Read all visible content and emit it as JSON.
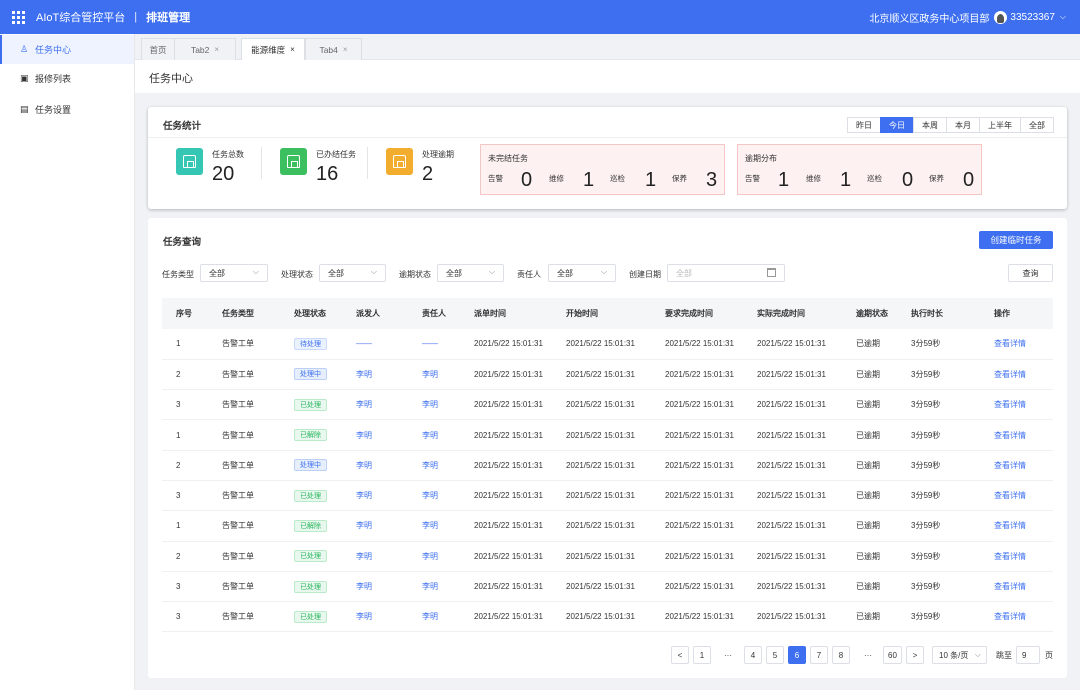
{
  "topbar": {
    "app_title": "AIoT综合管控平台",
    "separator": "|",
    "module_title": "排班管理",
    "project": "北京顺义区政务中心项目部",
    "user_id": "33523367"
  },
  "sidebar": {
    "items": [
      {
        "label": "任务中心",
        "icon": "user-icon",
        "active": true
      },
      {
        "label": "报修列表",
        "icon": "list-icon",
        "active": false
      },
      {
        "label": "任务设置",
        "icon": "settings-doc-icon",
        "active": false
      }
    ]
  },
  "tabs": [
    {
      "label": "首页",
      "closable": false,
      "active": false
    },
    {
      "label": "Tab2",
      "closable": true,
      "active": false
    },
    {
      "label": "能源维度",
      "closable": true,
      "active": true
    },
    {
      "label": "Tab4",
      "closable": true,
      "active": false
    }
  ],
  "close_glyph": "×",
  "page_title": "任务中心",
  "stats": {
    "title": "任务统计",
    "ranges": [
      "昨日",
      "今日",
      "本周",
      "本月",
      "上半年",
      "全部"
    ],
    "active_range": "今日",
    "kpis": [
      {
        "label": "任务总数",
        "value": "20",
        "color": "#36c6b4"
      },
      {
        "label": "已办结任务",
        "value": "16",
        "color": "#3cbf5e"
      },
      {
        "label": "处理逾期",
        "value": "2",
        "color": "#f3ad2e"
      }
    ],
    "unfinished": {
      "title": "未完结任务",
      "items": [
        {
          "label": "告警",
          "value": "0"
        },
        {
          "label": "维修",
          "value": "1"
        },
        {
          "label": "巡检",
          "value": "1"
        },
        {
          "label": "保养",
          "value": "3"
        }
      ]
    },
    "overdue": {
      "title": "逾期分布",
      "items": [
        {
          "label": "告警",
          "value": "1"
        },
        {
          "label": "维修",
          "value": "1"
        },
        {
          "label": "巡检",
          "value": "0"
        },
        {
          "label": "保养",
          "value": "0"
        }
      ]
    }
  },
  "query": {
    "title": "任务查询",
    "create_button": "创建临时任务",
    "filters": {
      "task_type": {
        "label": "任务类型",
        "value": "全部"
      },
      "status": {
        "label": "处理状态",
        "value": "全部"
      },
      "overdue": {
        "label": "逾期状态",
        "value": "全部"
      },
      "owner": {
        "label": "责任人",
        "value": "全部"
      },
      "created": {
        "label": "创建日期",
        "placeholder": "全部"
      }
    },
    "search_button": "查询",
    "columns": [
      "序号",
      "任务类型",
      "处理状态",
      "派发人",
      "责任人",
      "派单时间",
      "开始时间",
      "要求完成时间",
      "实际完成时间",
      "逾期状态",
      "执行时长",
      "操作"
    ],
    "rows": [
      {
        "no": "1",
        "type": "告警工单",
        "status": "待处理",
        "status_kind": "wait",
        "dispatcher": "——",
        "owner": "——",
        "dispatch_time": "2021/5/22  15:01:31",
        "start_time": "2021/5/22  15:01:31",
        "due_time": "2021/5/22  15:01:31",
        "done_time": "2021/5/22  15:01:31",
        "overdue": "已逾期",
        "duration": "3分59秒",
        "action": "查看详情"
      },
      {
        "no": "2",
        "type": "告警工单",
        "status": "处理中",
        "status_kind": "doing",
        "dispatcher": "李明",
        "owner": "李明",
        "dispatch_time": "2021/5/22  15:01:31",
        "start_time": "2021/5/22  15:01:31",
        "due_time": "2021/5/22  15:01:31",
        "done_time": "2021/5/22  15:01:31",
        "overdue": "已逾期",
        "duration": "3分59秒",
        "action": "查看详情"
      },
      {
        "no": "3",
        "type": "告警工单",
        "status": "已处理",
        "status_kind": "done",
        "dispatcher": "李明",
        "owner": "李明",
        "dispatch_time": "2021/5/22  15:01:31",
        "start_time": "2021/5/22  15:01:31",
        "due_time": "2021/5/22  15:01:31",
        "done_time": "2021/5/22  15:01:31",
        "overdue": "已逾期",
        "duration": "3分59秒",
        "action": "查看详情"
      },
      {
        "no": "1",
        "type": "告警工单",
        "status": "已解除",
        "status_kind": "done",
        "dispatcher": "李明",
        "owner": "李明",
        "dispatch_time": "2021/5/22  15:01:31",
        "start_time": "2021/5/22  15:01:31",
        "due_time": "2021/5/22  15:01:31",
        "done_time": "2021/5/22  15:01:31",
        "overdue": "已逾期",
        "duration": "3分59秒",
        "action": "查看详情"
      },
      {
        "no": "2",
        "type": "告警工单",
        "status": "处理中",
        "status_kind": "doing",
        "dispatcher": "李明",
        "owner": "李明",
        "dispatch_time": "2021/5/22  15:01:31",
        "start_time": "2021/5/22  15:01:31",
        "due_time": "2021/5/22  15:01:31",
        "done_time": "2021/5/22  15:01:31",
        "overdue": "已逾期",
        "duration": "3分59秒",
        "action": "查看详情"
      },
      {
        "no": "3",
        "type": "告警工单",
        "status": "已处理",
        "status_kind": "done",
        "dispatcher": "李明",
        "owner": "李明",
        "dispatch_time": "2021/5/22  15:01:31",
        "start_time": "2021/5/22  15:01:31",
        "due_time": "2021/5/22  15:01:31",
        "done_time": "2021/5/22  15:01:31",
        "overdue": "已逾期",
        "duration": "3分59秒",
        "action": "查看详情"
      },
      {
        "no": "1",
        "type": "告警工单",
        "status": "已解除",
        "status_kind": "done",
        "dispatcher": "李明",
        "owner": "李明",
        "dispatch_time": "2021/5/22  15:01:31",
        "start_time": "2021/5/22  15:01:31",
        "due_time": "2021/5/22  15:01:31",
        "done_time": "2021/5/22  15:01:31",
        "overdue": "已逾期",
        "duration": "3分59秒",
        "action": "查看详情"
      },
      {
        "no": "2",
        "type": "告警工单",
        "status": "已处理",
        "status_kind": "done",
        "dispatcher": "李明",
        "owner": "李明",
        "dispatch_time": "2021/5/22  15:01:31",
        "start_time": "2021/5/22  15:01:31",
        "due_time": "2021/5/22  15:01:31",
        "done_time": "2021/5/22  15:01:31",
        "overdue": "已逾期",
        "duration": "3分59秒",
        "action": "查看详情"
      },
      {
        "no": "3",
        "type": "告警工单",
        "status": "已处理",
        "status_kind": "done",
        "dispatcher": "李明",
        "owner": "李明",
        "dispatch_time": "2021/5/22  15:01:31",
        "start_time": "2021/5/22  15:01:31",
        "due_time": "2021/5/22  15:01:31",
        "done_time": "2021/5/22  15:01:31",
        "overdue": "已逾期",
        "duration": "3分59秒",
        "action": "查看详情"
      },
      {
        "no": "3",
        "type": "告警工单",
        "status": "已处理",
        "status_kind": "done",
        "dispatcher": "李明",
        "owner": "李明",
        "dispatch_time": "2021/5/22  15:01:31",
        "start_time": "2021/5/22  15:01:31",
        "due_time": "2021/5/22  15:01:31",
        "done_time": "2021/5/22  15:01:31",
        "overdue": "已逾期",
        "duration": "3分59秒",
        "action": "查看详情"
      }
    ],
    "pagination": {
      "prev": "<",
      "next": ">",
      "pages": [
        "1",
        "···",
        "4",
        "5",
        "6",
        "7",
        "8",
        "···",
        "60"
      ],
      "current": "6",
      "page_size": "10 条/页",
      "goto_label": "跳至",
      "goto_value": "9",
      "page_unit": "页"
    }
  },
  "colors": {
    "primary": "#3d6ff0",
    "topbar": "#3d6ff0",
    "success": "#27b45a",
    "warning_bg": "#fdf1f1"
  }
}
